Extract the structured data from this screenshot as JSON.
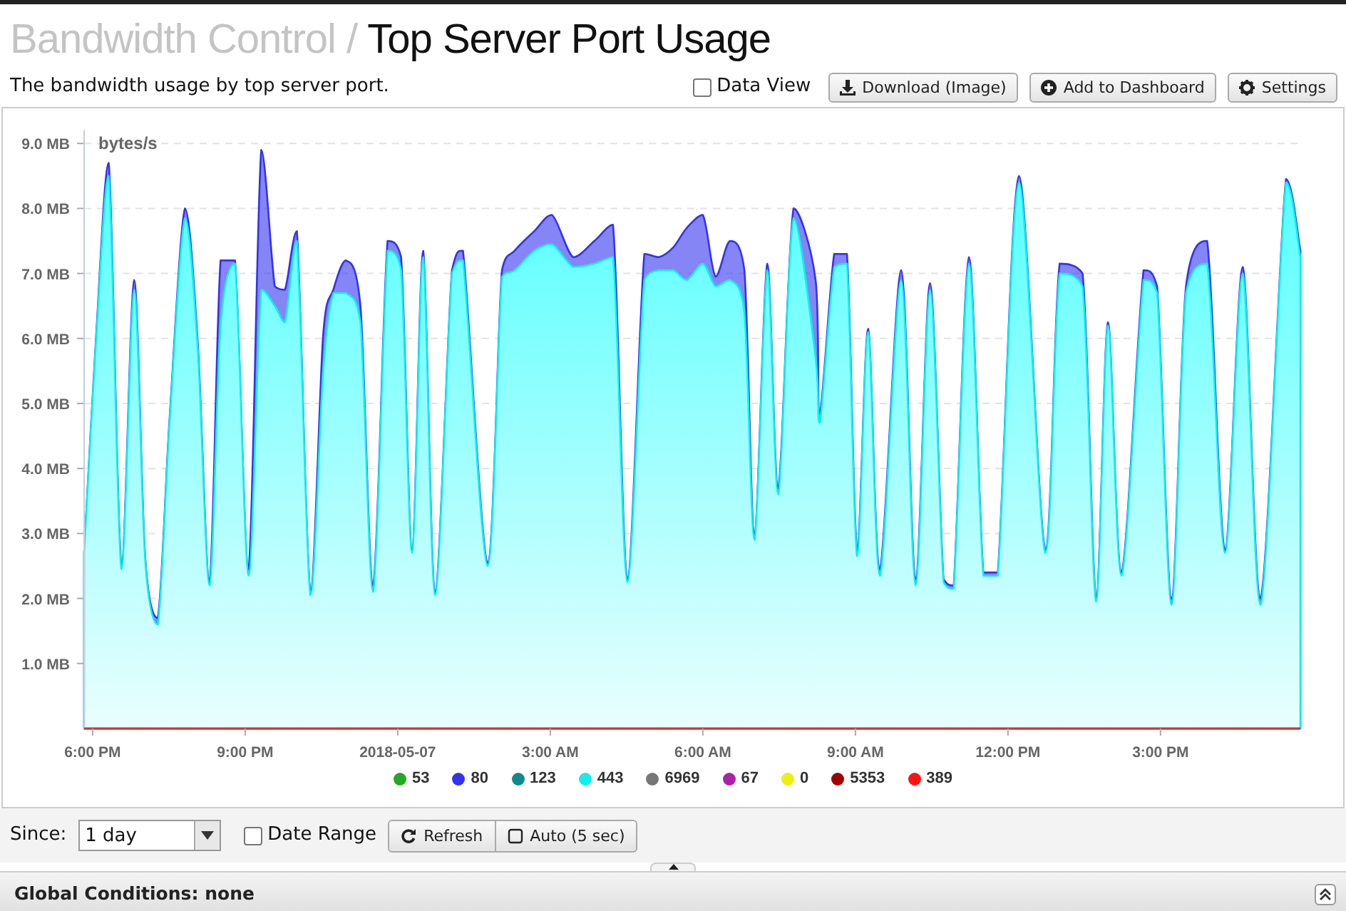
{
  "header": {
    "section": "Bandwidth Control /",
    "title": "Top Server Port Usage"
  },
  "description": "The bandwidth usage by top server port.",
  "data_view": {
    "label": "Data View",
    "checked": false
  },
  "buttons": [
    {
      "label": "Download (Image)",
      "kind": "download"
    },
    {
      "label": "Add to Dashboard",
      "kind": "add"
    },
    {
      "label": "Settings",
      "kind": "settings"
    }
  ],
  "chart_data": {
    "type": "area",
    "stacked": true,
    "grid": true,
    "ylabel": "bytes/s",
    "xlim": [
      "2018-05-06 17:50",
      "2018-05-07 17:45"
    ],
    "ylim": [
      0,
      9.2
    ],
    "yticks": [
      {
        "value": 1,
        "label": "1.0 MB"
      },
      {
        "value": 2,
        "label": "2.0 MB"
      },
      {
        "value": 3,
        "label": "3.0 MB"
      },
      {
        "value": 4,
        "label": "4.0 MB"
      },
      {
        "value": 5,
        "label": "5.0 MB"
      },
      {
        "value": 6,
        "label": "6.0 MB"
      },
      {
        "value": 7,
        "label": "7.0 MB"
      },
      {
        "value": 8,
        "label": "8.0 MB"
      },
      {
        "value": 9,
        "label": "9.0 MB"
      }
    ],
    "xticks": [
      {
        "value": "2018-05-06 18:00",
        "label": "6:00 PM"
      },
      {
        "value": "2018-05-06 21:00",
        "label": "9:00 PM"
      },
      {
        "value": "2018-05-07 00:00",
        "label": "2018-05-07"
      },
      {
        "value": "2018-05-07 03:00",
        "label": "3:00 AM"
      },
      {
        "value": "2018-05-07 06:00",
        "label": "6:00 AM"
      },
      {
        "value": "2018-05-07 09:00",
        "label": "9:00 AM"
      },
      {
        "value": "2018-05-07 12:00",
        "label": "12:00 PM"
      },
      {
        "value": "2018-05-07 15:00",
        "label": "3:00 PM"
      }
    ],
    "x": [
      "2018-05-06 17:50",
      "2018-05-06 18:04",
      "2018-05-06 18:19",
      "2018-05-06 18:34",
      "2018-05-06 18:49",
      "2018-05-06 19:02",
      "2018-05-06 19:17",
      "2018-05-06 19:31",
      "2018-05-06 19:49",
      "2018-05-06 20:04",
      "2018-05-06 20:18",
      "2018-05-06 20:31",
      "2018-05-06 20:48",
      "2018-05-06 21:04",
      "2018-05-06 21:19",
      "2018-05-06 21:35",
      "2018-05-06 21:47",
      "2018-05-06 22:01",
      "2018-05-06 22:17",
      "2018-05-06 22:32",
      "2018-05-06 22:44",
      "2018-05-06 22:59",
      "2018-05-06 23:16",
      "2018-05-06 23:31",
      "2018-05-06 23:48",
      "2018-05-07 00:04",
      "2018-05-07 00:17",
      "2018-05-07 00:30",
      "2018-05-07 00:44",
      "2018-05-07 01:04",
      "2018-05-07 01:17",
      "2018-05-07 01:46",
      "2018-05-07 02:03",
      "2018-05-07 02:18",
      "2018-05-07 02:41",
      "2018-05-07 03:02",
      "2018-05-07 03:27",
      "2018-05-07 03:52",
      "2018-05-07 04:14",
      "2018-05-07 04:31",
      "2018-05-07 04:51",
      "2018-05-07 05:08",
      "2018-05-07 05:25",
      "2018-05-07 05:41",
      "2018-05-07 06:00",
      "2018-05-07 06:15",
      "2018-05-07 06:32",
      "2018-05-07 06:49",
      "2018-05-07 07:01",
      "2018-05-07 07:16",
      "2018-05-07 07:29",
      "2018-05-07 07:47",
      "2018-05-07 08:13",
      "2018-05-07 08:18",
      "2018-05-07 08:35",
      "2018-05-07 08:50",
      "2018-05-07 09:02",
      "2018-05-07 09:15",
      "2018-05-07 09:29",
      "2018-05-07 09:54",
      "2018-05-07 10:11",
      "2018-05-07 10:28",
      "2018-05-07 10:44",
      "2018-05-07 10:56",
      "2018-05-07 11:14",
      "2018-05-07 11:31",
      "2018-05-07 11:48",
      "2018-05-07 12:13",
      "2018-05-07 12:44",
      "2018-05-07 13:01",
      "2018-05-07 13:28",
      "2018-05-07 13:44",
      "2018-05-07 13:58",
      "2018-05-07 14:14",
      "2018-05-07 14:40",
      "2018-05-07 14:56",
      "2018-05-07 15:13",
      "2018-05-07 15:30",
      "2018-05-07 15:55",
      "2018-05-07 16:16",
      "2018-05-07 16:37",
      "2018-05-07 16:58",
      "2018-05-07 17:28",
      "2018-05-07 17:45"
    ],
    "series": [
      {
        "name": "53",
        "color": "#22aa22",
        "values": [
          null,
          null,
          null,
          null,
          null,
          null,
          null,
          null,
          null,
          null,
          null,
          null,
          null,
          null,
          null,
          null,
          null,
          null,
          null,
          null,
          null,
          null,
          null,
          null,
          null,
          null,
          null,
          null,
          null,
          null,
          null,
          null,
          null,
          null,
          null,
          null,
          null,
          null,
          null,
          null,
          null,
          null,
          null,
          null,
          null,
          null,
          null,
          null,
          null,
          null,
          null,
          null,
          null,
          null,
          null,
          null,
          null,
          null,
          null,
          null,
          null,
          null,
          null,
          null,
          null,
          null,
          null,
          null,
          null,
          null,
          null,
          null,
          null,
          null,
          null,
          null,
          null,
          null,
          null,
          null,
          null,
          null,
          null,
          null
        ]
      },
      {
        "name": "80",
        "color": "#3333ee",
        "values": [
          0,
          0.05,
          0.2,
          0.05,
          0.15,
          0.05,
          0.1,
          0.05,
          0.15,
          0.1,
          0.05,
          1.0,
          0.05,
          0.1,
          2.15,
          0.3,
          0.5,
          0.15,
          0.05,
          0.55,
          0.05,
          0.5,
          0.25,
          0.1,
          0.15,
          0.2,
          0.05,
          0.1,
          0.05,
          0.05,
          0.15,
          0.05,
          0.1,
          0.3,
          0.3,
          0.45,
          0.15,
          0.35,
          0.5,
          0.05,
          0.4,
          0.2,
          0.35,
          0.8,
          0.75,
          0.15,
          0.6,
          0.65,
          0.1,
          0.1,
          0.1,
          0.15,
          1.2,
          0.15,
          0.2,
          0.15,
          0.1,
          0.05,
          0.1,
          0.15,
          0.1,
          0.1,
          0.05,
          0.05,
          0.1,
          0.05,
          0.05,
          0.1,
          0.05,
          0.15,
          0.2,
          0.05,
          0.05,
          0.05,
          0.15,
          0.1,
          0.1,
          0.1,
          0.35,
          0.05,
          0.1,
          0.1,
          0.05,
          0.1
        ]
      },
      {
        "name": "123",
        "color": "#138a8a",
        "values": [
          null,
          null,
          null,
          null,
          null,
          null,
          null,
          null,
          null,
          null,
          null,
          null,
          null,
          null,
          null,
          null,
          null,
          null,
          null,
          null,
          null,
          null,
          null,
          null,
          null,
          null,
          null,
          null,
          null,
          null,
          null,
          null,
          null,
          null,
          null,
          null,
          null,
          null,
          null,
          null,
          null,
          null,
          null,
          null,
          null,
          null,
          null,
          null,
          null,
          null,
          null,
          null,
          null,
          null,
          null,
          null,
          null,
          null,
          null,
          null,
          null,
          null,
          null,
          null,
          null,
          null,
          null,
          null,
          null,
          null,
          null,
          null,
          null,
          null,
          null,
          null,
          null,
          null,
          null,
          null,
          null,
          null,
          null,
          null
        ]
      },
      {
        "name": "443",
        "color": "#11eeee",
        "values": [
          2.7,
          5.95,
          8.5,
          2.45,
          6.75,
          2.6,
          1.6,
          4.75,
          7.85,
          5.85,
          2.2,
          6.2,
          7.15,
          2.35,
          6.75,
          6.5,
          6.25,
          7.5,
          2.05,
          5.5,
          6.7,
          6.7,
          6.25,
          2.1,
          7.35,
          7.05,
          2.7,
          7.25,
          2.05,
          7.0,
          7.2,
          2.5,
          6.95,
          7.05,
          7.35,
          7.45,
          7.1,
          7.15,
          7.25,
          2.25,
          6.9,
          7.05,
          7.05,
          6.9,
          7.15,
          6.8,
          6.9,
          6.4,
          2.9,
          7.05,
          3.6,
          7.85,
          5.7,
          4.7,
          7.1,
          7.15,
          2.65,
          6.1,
          2.35,
          6.9,
          2.2,
          6.75,
          2.25,
          2.15,
          7.15,
          2.35,
          2.35,
          8.4,
          2.7,
          7.0,
          6.8,
          1.95,
          6.2,
          2.35,
          6.9,
          6.7,
          1.9,
          6.7,
          7.15,
          2.7,
          7.0,
          1.9,
          8.4,
          7.25
        ]
      },
      {
        "name": "6969",
        "color": "#777777",
        "values": [
          null,
          null,
          null,
          null,
          null,
          null,
          null,
          null,
          null,
          null,
          null,
          null,
          null,
          null,
          null,
          null,
          null,
          null,
          null,
          null,
          null,
          null,
          null,
          null,
          null,
          null,
          null,
          null,
          null,
          null,
          null,
          null,
          null,
          null,
          null,
          null,
          null,
          null,
          null,
          null,
          null,
          null,
          null,
          null,
          null,
          null,
          null,
          null,
          null,
          null,
          null,
          null,
          null,
          null,
          null,
          null,
          null,
          null,
          null,
          null,
          null,
          null,
          null,
          null,
          null,
          null,
          null,
          null,
          null,
          null,
          null,
          null,
          null,
          null,
          null,
          null,
          null,
          null,
          null,
          null,
          null,
          null,
          null,
          null
        ]
      },
      {
        "name": "67",
        "color": "#aa22aa",
        "values": [
          null,
          null,
          null,
          null,
          null,
          null,
          null,
          null,
          null,
          null,
          null,
          null,
          null,
          null,
          null,
          null,
          null,
          null,
          null,
          null,
          null,
          null,
          null,
          null,
          null,
          null,
          null,
          null,
          null,
          null,
          null,
          null,
          null,
          null,
          null,
          null,
          null,
          null,
          null,
          null,
          null,
          null,
          null,
          null,
          null,
          null,
          null,
          null,
          null,
          null,
          null,
          null,
          null,
          null,
          null,
          null,
          null,
          null,
          null,
          null,
          null,
          null,
          null,
          null,
          null,
          null,
          null,
          null,
          null,
          null,
          null,
          null,
          null,
          null,
          null,
          null,
          null,
          null,
          null,
          null,
          null,
          null,
          null,
          null
        ]
      },
      {
        "name": "0",
        "color": "#eeee11",
        "values": [
          null,
          null,
          null,
          null,
          null,
          null,
          null,
          null,
          null,
          null,
          null,
          null,
          null,
          null,
          null,
          null,
          null,
          null,
          null,
          null,
          null,
          null,
          null,
          null,
          null,
          null,
          null,
          null,
          null,
          null,
          null,
          null,
          null,
          null,
          null,
          null,
          null,
          null,
          null,
          null,
          null,
          null,
          null,
          null,
          null,
          null,
          null,
          null,
          null,
          null,
          null,
          null,
          null,
          null,
          null,
          null,
          null,
          null,
          null,
          null,
          null,
          null,
          null,
          null,
          null,
          null,
          null,
          null,
          null,
          null,
          null,
          null,
          null,
          null,
          null,
          null,
          null,
          null,
          null,
          null,
          null,
          null,
          null,
          null
        ]
      },
      {
        "name": "5353",
        "color": "#a00000",
        "values": [
          null,
          null,
          null,
          null,
          null,
          null,
          null,
          null,
          null,
          null,
          null,
          null,
          null,
          null,
          null,
          null,
          null,
          null,
          null,
          null,
          null,
          null,
          null,
          null,
          null,
          null,
          null,
          null,
          null,
          null,
          null,
          null,
          null,
          null,
          null,
          null,
          null,
          null,
          null,
          null,
          null,
          null,
          null,
          null,
          null,
          null,
          null,
          null,
          null,
          null,
          null,
          null,
          null,
          null,
          null,
          null,
          null,
          null,
          null,
          null,
          null,
          null,
          null,
          null,
          null,
          null,
          null,
          null,
          null,
          null,
          null,
          null,
          null,
          null,
          null,
          null,
          null,
          null,
          null,
          null,
          null,
          null,
          null,
          null
        ]
      },
      {
        "name": "389",
        "color": "#ff1111",
        "values": [
          null,
          null,
          null,
          null,
          null,
          null,
          null,
          null,
          null,
          null,
          null,
          null,
          null,
          null,
          null,
          null,
          null,
          null,
          null,
          null,
          null,
          null,
          null,
          null,
          null,
          null,
          null,
          null,
          null,
          null,
          null,
          null,
          null,
          null,
          null,
          null,
          null,
          null,
          null,
          null,
          null,
          null,
          null,
          null,
          null,
          null,
          null,
          null,
          null,
          null,
          null,
          null,
          null,
          null,
          null,
          null,
          null,
          null,
          null,
          null,
          null,
          null,
          null,
          null,
          null,
          null,
          null,
          null,
          null,
          null,
          null,
          null,
          null,
          null,
          null,
          null,
          null,
          null,
          null,
          null,
          null,
          null,
          null,
          null
        ]
      }
    ]
  },
  "since": {
    "label": "Since:",
    "value": "1 day"
  },
  "date_range": {
    "label": "Date Range",
    "checked": false
  },
  "refresh_buttons": [
    {
      "label": "Refresh",
      "kind": "refresh"
    },
    {
      "label": "Auto (5 sec)",
      "kind": "auto"
    }
  ],
  "global_conditions": "Global Conditions: none"
}
